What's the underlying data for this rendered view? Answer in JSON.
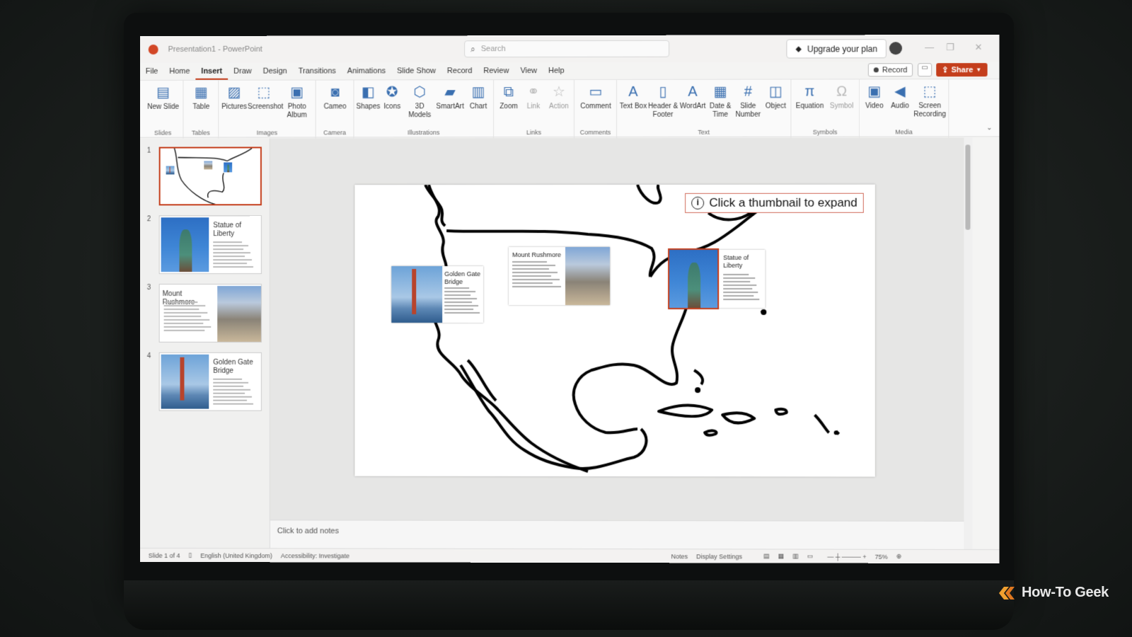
{
  "app": {
    "doc_title": "Presentation1 - PowerPoint",
    "search_placeholder": "Search",
    "upgrade_label": "Upgrade your plan",
    "record_label": "Record",
    "share_label": "Share"
  },
  "menu": [
    "File",
    "Home",
    "Insert",
    "Draw",
    "Design",
    "Transitions",
    "Animations",
    "Slide Show",
    "Record",
    "Review",
    "View",
    "Help"
  ],
  "active_tab": "Insert",
  "ribbon": {
    "groups": [
      {
        "label": "Slides",
        "buttons": [
          {
            "label": "New Slide",
            "icon": "new-slide-icon",
            "glyph": "▤"
          }
        ]
      },
      {
        "label": "Tables",
        "buttons": [
          {
            "label": "Table",
            "icon": "table-icon",
            "glyph": "▦"
          }
        ]
      },
      {
        "label": "Images",
        "buttons": [
          {
            "label": "Pictures",
            "icon": "pictures-icon",
            "glyph": "▨"
          },
          {
            "label": "Screenshot",
            "icon": "screenshot-icon",
            "glyph": "⬚"
          },
          {
            "label": "Photo Album",
            "icon": "photo-album-icon",
            "glyph": "▣"
          }
        ]
      },
      {
        "label": "Camera",
        "buttons": [
          {
            "label": "Cameo",
            "icon": "cameo-icon",
            "glyph": "◙"
          }
        ]
      },
      {
        "label": "Illustrations",
        "buttons": [
          {
            "label": "Shapes",
            "icon": "shapes-icon",
            "glyph": "◧"
          },
          {
            "label": "Icons",
            "icon": "icons-icon",
            "glyph": "✪"
          },
          {
            "label": "3D Models",
            "icon": "3d-models-icon",
            "glyph": "⬡"
          },
          {
            "label": "SmartArt",
            "icon": "smartart-icon",
            "glyph": "▰"
          },
          {
            "label": "Chart",
            "icon": "chart-icon",
            "glyph": "▥"
          }
        ]
      },
      {
        "label": "Links",
        "buttons": [
          {
            "label": "Zoom",
            "icon": "zoom-icon",
            "glyph": "⧉"
          },
          {
            "label": "Link",
            "icon": "link-icon",
            "glyph": "⚭",
            "dim": true
          },
          {
            "label": "Action",
            "icon": "action-icon",
            "glyph": "☆",
            "dim": true
          }
        ]
      },
      {
        "label": "Comments",
        "buttons": [
          {
            "label": "Comment",
            "icon": "comment-icon",
            "glyph": "▭"
          }
        ]
      },
      {
        "label": "Text",
        "buttons": [
          {
            "label": "Text Box",
            "icon": "text-box-icon",
            "glyph": "A"
          },
          {
            "label": "Header & Footer",
            "icon": "header-footer-icon",
            "glyph": "▯"
          },
          {
            "label": "WordArt",
            "icon": "wordart-icon",
            "glyph": "A"
          },
          {
            "label": "Date & Time",
            "icon": "date-time-icon",
            "glyph": "▦"
          },
          {
            "label": "Slide Number",
            "icon": "slide-number-icon",
            "glyph": "#"
          },
          {
            "label": "Object",
            "icon": "object-icon",
            "glyph": "◫"
          }
        ]
      },
      {
        "label": "Symbols",
        "buttons": [
          {
            "label": "Equation",
            "icon": "equation-icon",
            "glyph": "π"
          },
          {
            "label": "Symbol",
            "icon": "symbol-icon",
            "glyph": "Ω",
            "dim": true
          }
        ]
      },
      {
        "label": "Media",
        "buttons": [
          {
            "label": "Video",
            "icon": "video-icon",
            "glyph": "▣"
          },
          {
            "label": "Audio",
            "icon": "audio-icon",
            "glyph": "◀"
          },
          {
            "label": "Screen Recording",
            "icon": "screen-recording-icon",
            "glyph": "⬚"
          }
        ]
      }
    ]
  },
  "thumbnails": [
    {
      "num": "1",
      "title": "",
      "kind": "map",
      "selected": true
    },
    {
      "num": "2",
      "title": "Statue of Liberty",
      "kind": "liberty",
      "selected": false
    },
    {
      "num": "3",
      "title": "Mount Rushmore",
      "kind": "rushmore",
      "selected": false
    },
    {
      "num": "4",
      "title": "Golden Gate Bridge",
      "kind": "gate",
      "selected": false
    }
  ],
  "slide": {
    "tip": "Click a thumbnail to expand",
    "cards": [
      {
        "title": "Golden Gate Bridge",
        "kind": "gate"
      },
      {
        "title": "Mount Rushmore",
        "kind": "rushmore"
      },
      {
        "title": "Statue of Liberty",
        "kind": "liberty"
      }
    ]
  },
  "notes_placeholder": "Click to add notes",
  "status": {
    "slide_of": "Slide 1 of 4",
    "language": "English (United Kingdom)",
    "accessibility": "Accessibility: Investigate",
    "notes": "Notes",
    "display_settings": "Display Settings",
    "zoom": "75%"
  },
  "colors": {
    "accent": "#c43e1c",
    "ribbon_icon": "#3a6fb0"
  },
  "watermark": "How-To Geek"
}
